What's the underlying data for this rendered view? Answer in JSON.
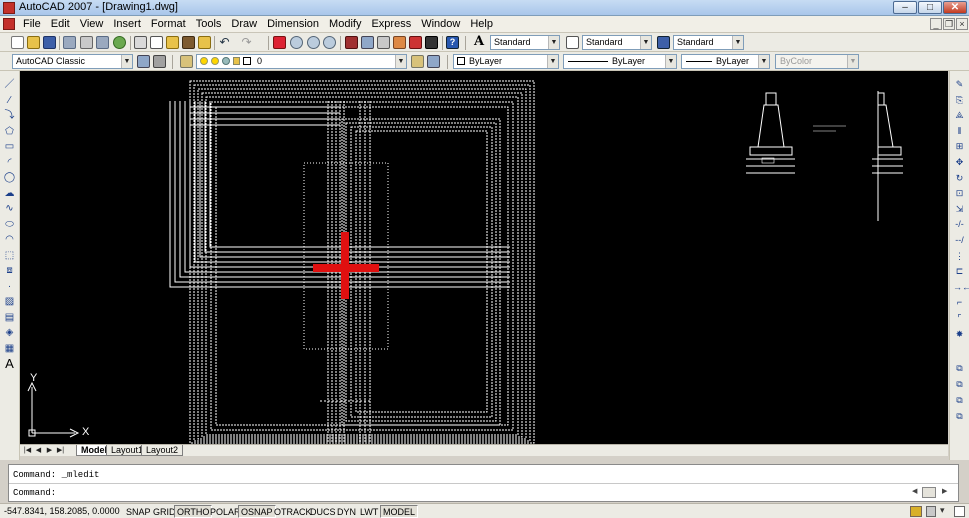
{
  "window": {
    "title": "AutoCAD 2007 - [Drawing1.dwg]",
    "min_label": "–",
    "max_label": "□",
    "close_label": "✕",
    "doc_min_label": "_",
    "doc_restore_label": "❐",
    "doc_close_label": "×"
  },
  "menu": [
    "File",
    "Edit",
    "View",
    "Insert",
    "Format",
    "Tools",
    "Draw",
    "Dimension",
    "Modify",
    "Express",
    "Window",
    "Help"
  ],
  "toolbar_standard": {
    "text_style": "Standard",
    "dim_style": "Standard",
    "table_style": "Standard"
  },
  "toolbar_workspace": {
    "workspace": "AutoCAD Classic",
    "layer": "0",
    "color": "ByLayer",
    "linetype": "ByLayer",
    "lineweight": "ByLayer",
    "plot_style": "ByColor"
  },
  "left_tools": [
    "line-icon",
    "construction-line-icon",
    "polyline-icon",
    "polygon-icon",
    "rectangle-icon",
    "arc-icon",
    "circle-icon",
    "revision-cloud-icon",
    "spline-icon",
    "ellipse-icon",
    "ellipse-arc-icon",
    "insert-block-icon",
    "make-block-icon",
    "point-icon",
    "hatch-icon",
    "gradient-icon",
    "region-icon",
    "table-icon",
    "multiline-text-icon"
  ],
  "left_text_tool": "A",
  "right_tools": [
    "erase-icon",
    "copy-icon",
    "mirror-icon",
    "offset-icon",
    "array-icon",
    "move-icon",
    "rotate-icon",
    "scale-icon",
    "stretch-icon",
    "trim-icon",
    "extend-icon",
    "break-at-point-icon",
    "break-icon",
    "join-icon",
    "chamfer-icon",
    "fillet-icon",
    "explode-icon",
    "draworder-front-icon",
    "draworder-back-icon",
    "draworder-above-icon",
    "draworder-under-icon"
  ],
  "ucs": {
    "x_label": "X",
    "y_label": "Y"
  },
  "layout_tabs": {
    "nav": [
      "|◀",
      "◀",
      "▶",
      "▶|"
    ],
    "tabs": [
      "Model",
      "Layout1",
      "Layout2"
    ],
    "active": "Model"
  },
  "command": {
    "history": "Command:  _mledit",
    "prompt": "Command:"
  },
  "status": {
    "coords": "-547.8341, 158.2085, 0.0000",
    "buttons": [
      {
        "label": "SNAP",
        "on": false
      },
      {
        "label": "GRID",
        "on": false
      },
      {
        "label": "ORTHO",
        "on": true
      },
      {
        "label": "POLAR",
        "on": false
      },
      {
        "label": "OSNAP",
        "on": true
      },
      {
        "label": "OTRACK",
        "on": false
      },
      {
        "label": "DUCS",
        "on": false
      },
      {
        "label": "DYN",
        "on": false
      },
      {
        "label": "LWT",
        "on": false
      },
      {
        "label": "MODEL",
        "on": true
      }
    ]
  },
  "colors": {
    "canvas": "#000000",
    "lines": "#ffffff",
    "crosshair": "#e01010",
    "titlebar": "#b8d0ee"
  }
}
